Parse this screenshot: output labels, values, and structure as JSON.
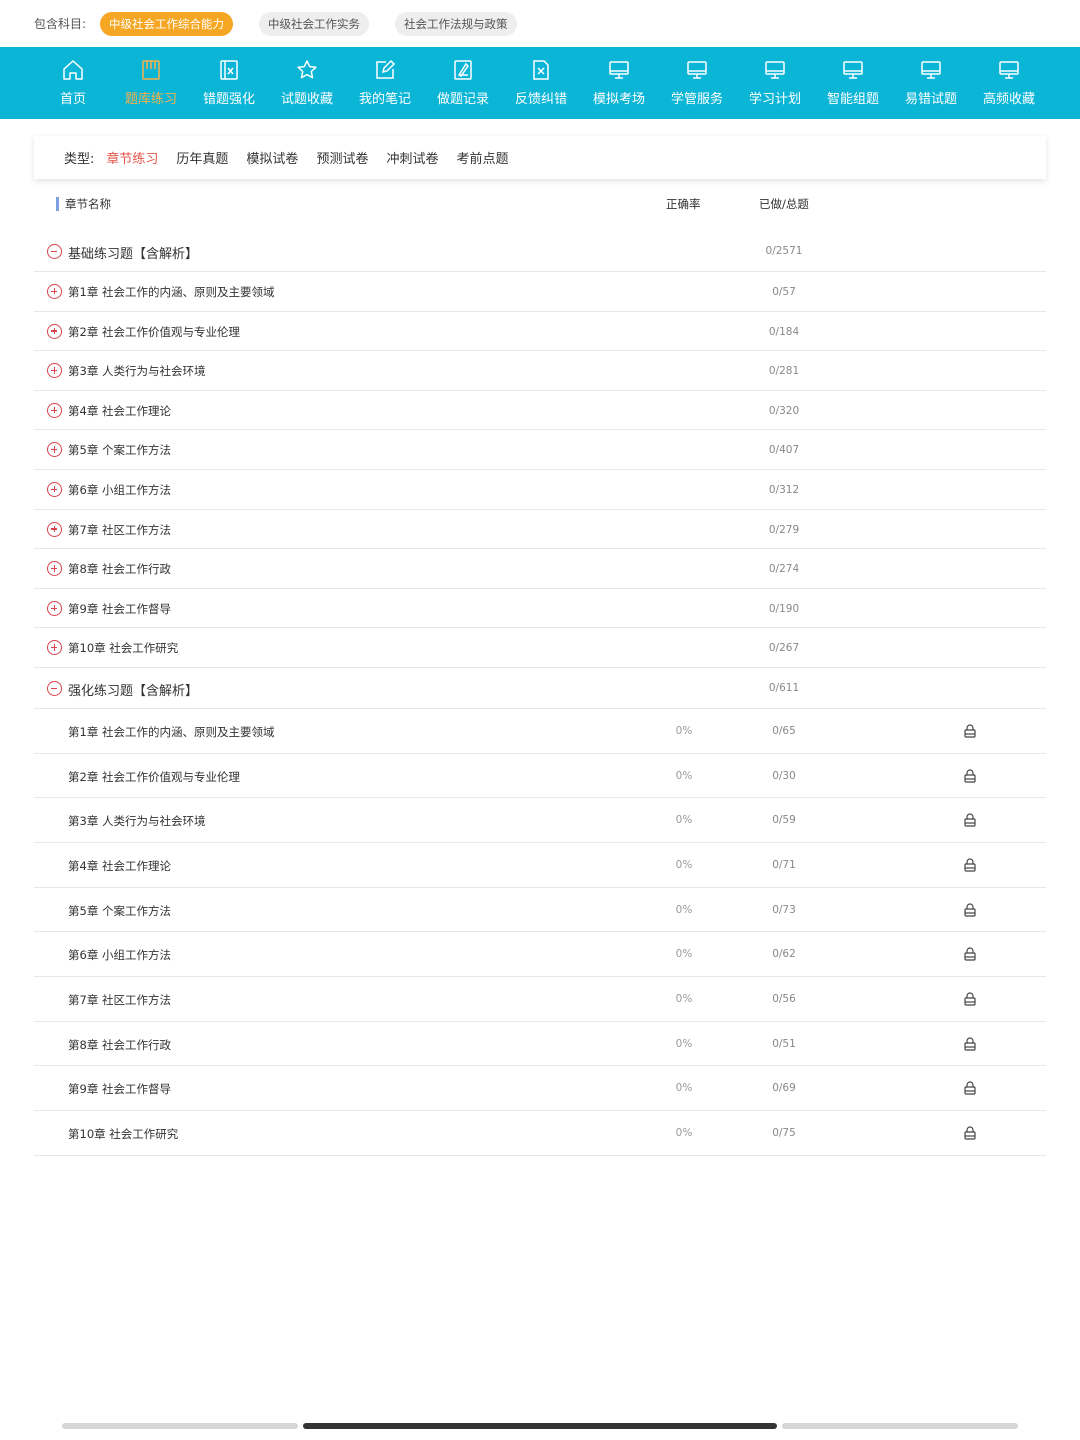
{
  "subjects": {
    "label": "包含科目:",
    "items": [
      {
        "label": "中级社会工作综合能力",
        "active": true
      },
      {
        "label": "中级社会工作实务",
        "active": false
      },
      {
        "label": "社会工作法规与政策",
        "active": false
      }
    ]
  },
  "nav": [
    {
      "label": "首页",
      "icon": "home-icon",
      "active": false
    },
    {
      "label": "题库练习",
      "icon": "question-bank-icon",
      "active": true
    },
    {
      "label": "错题强化",
      "icon": "wrong-question-icon",
      "active": false
    },
    {
      "label": "试题收藏",
      "icon": "star-icon",
      "active": false
    },
    {
      "label": "我的笔记",
      "icon": "note-edit-icon",
      "active": false
    },
    {
      "label": "做题记录",
      "icon": "record-icon",
      "active": false
    },
    {
      "label": "反馈纠错",
      "icon": "feedback-icon",
      "active": false
    },
    {
      "label": "模拟考场",
      "icon": "monitor-icon",
      "active": false
    },
    {
      "label": "学管服务",
      "icon": "monitor-icon",
      "active": false
    },
    {
      "label": "学习计划",
      "icon": "monitor-icon",
      "active": false
    },
    {
      "label": "智能组题",
      "icon": "monitor-icon",
      "active": false
    },
    {
      "label": "易错试题",
      "icon": "monitor-icon",
      "active": false
    },
    {
      "label": "高频收藏",
      "icon": "monitor-icon",
      "active": false
    }
  ],
  "types": {
    "label": "类型:",
    "items": [
      {
        "label": "章节练习",
        "active": true
      },
      {
        "label": "历年真题",
        "active": false
      },
      {
        "label": "模拟试卷",
        "active": false
      },
      {
        "label": "预测试卷",
        "active": false
      },
      {
        "label": "冲刺试卷",
        "active": false
      },
      {
        "label": "考前点题",
        "active": false
      }
    ]
  },
  "table": {
    "col_name": "章节名称",
    "col_accuracy": "正确率",
    "col_done": "已做/总题"
  },
  "groups": [
    {
      "title": "基础练习题【含解析】",
      "count": "0/2571",
      "expanded": true,
      "chapters": [
        {
          "title": "第1章 社会工作的内涵、原则及主要领域",
          "count": "0/57"
        },
        {
          "title": "第2章 社会工作价值观与专业伦理",
          "count": "0/184"
        },
        {
          "title": "第3章 人类行为与社会环境",
          "count": "0/281"
        },
        {
          "title": "第4章 社会工作理论",
          "count": "0/320"
        },
        {
          "title": "第5章 个案工作方法",
          "count": "0/407"
        },
        {
          "title": "第6章 小组工作方法",
          "count": "0/312"
        },
        {
          "title": "第7章 社区工作方法",
          "count": "0/279"
        },
        {
          "title": "第8章 社会工作行政",
          "count": "0/274"
        },
        {
          "title": "第9章 社会工作督导",
          "count": "0/190"
        },
        {
          "title": "第10章 社会工作研究",
          "count": "0/267"
        }
      ]
    },
    {
      "title": "强化练习题【含解析】",
      "count": "0/611",
      "expanded": true,
      "chapters": [
        {
          "title": "第1章 社会工作的内涵、原则及主要领域",
          "accuracy": "0%",
          "count": "0/65",
          "locked": true
        },
        {
          "title": "第2章 社会工作价值观与专业伦理",
          "accuracy": "0%",
          "count": "0/30",
          "locked": true
        },
        {
          "title": "第3章 人类行为与社会环境",
          "accuracy": "0%",
          "count": "0/59",
          "locked": true
        },
        {
          "title": "第4章 社会工作理论",
          "accuracy": "0%",
          "count": "0/71",
          "locked": true
        },
        {
          "title": "第5章 个案工作方法",
          "accuracy": "0%",
          "count": "0/73",
          "locked": true
        },
        {
          "title": "第6章 小组工作方法",
          "accuracy": "0%",
          "count": "0/62",
          "locked": true
        },
        {
          "title": "第7章 社区工作方法",
          "accuracy": "0%",
          "count": "0/56",
          "locked": true
        },
        {
          "title": "第8章 社会工作行政",
          "accuracy": "0%",
          "count": "0/51",
          "locked": true
        },
        {
          "title": "第9章 社会工作督导",
          "accuracy": "0%",
          "count": "0/69",
          "locked": true
        },
        {
          "title": "第10章 社会工作研究",
          "accuracy": "0%",
          "count": "0/75",
          "locked": true
        }
      ]
    }
  ],
  "colors": {
    "nav_bg": "#0bb5d6",
    "nav_active": "#f7b24a",
    "subject_active": "#f5a623",
    "type_active": "#e4574a",
    "expand_icon": "#d9434c"
  }
}
